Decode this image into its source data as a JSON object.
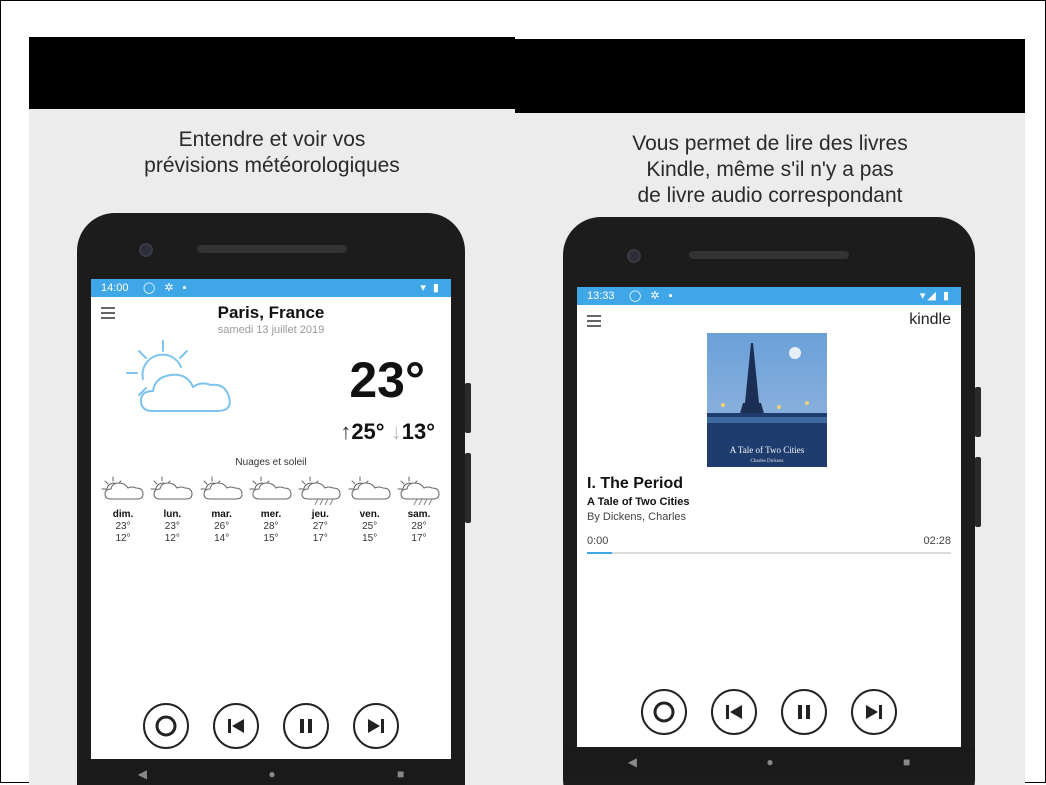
{
  "left_panel": {
    "caption_lines": [
      "Entendre et voir vos",
      "prévisions météorologiques"
    ],
    "status": {
      "time": "14:00"
    },
    "weather": {
      "city": "Paris, France",
      "date": "samedi 13 juillet 2019",
      "temperature": "23°",
      "high": "25°",
      "low": "13°",
      "condition": "Nuages et soleil",
      "forecast": [
        {
          "day": "dim.",
          "high": "23°",
          "low": "12°",
          "rain": false
        },
        {
          "day": "lun.",
          "high": "23°",
          "low": "12°",
          "rain": false
        },
        {
          "day": "mar.",
          "high": "26°",
          "low": "14°",
          "rain": false
        },
        {
          "day": "mer.",
          "high": "28°",
          "low": "15°",
          "rain": false
        },
        {
          "day": "jeu.",
          "high": "27°",
          "low": "17°",
          "rain": true
        },
        {
          "day": "ven.",
          "high": "25°",
          "low": "15°",
          "rain": false
        },
        {
          "day": "sam.",
          "high": "28°",
          "low": "17°",
          "rain": true
        }
      ]
    }
  },
  "right_panel": {
    "caption_lines": [
      "Vous permet de lire des livres",
      "Kindle, même s'il n'y a pas",
      "de livre audio correspondant"
    ],
    "status": {
      "time": "13:33"
    },
    "kindle": {
      "logo": "kindle",
      "cover_title": "A Tale of Two Cities",
      "cover_author": "Charles Dickens",
      "chapter": "I. The Period",
      "book_title": "A Tale of Two Cities",
      "author": "By Dickens, Charles",
      "time_elapsed": "0:00",
      "time_total": "02:28",
      "progress": 0.07
    }
  },
  "colors": {
    "status_bar": "#3fa6e8",
    "accent": "#3fa6e8",
    "phone_body": "#1c1c1c"
  }
}
